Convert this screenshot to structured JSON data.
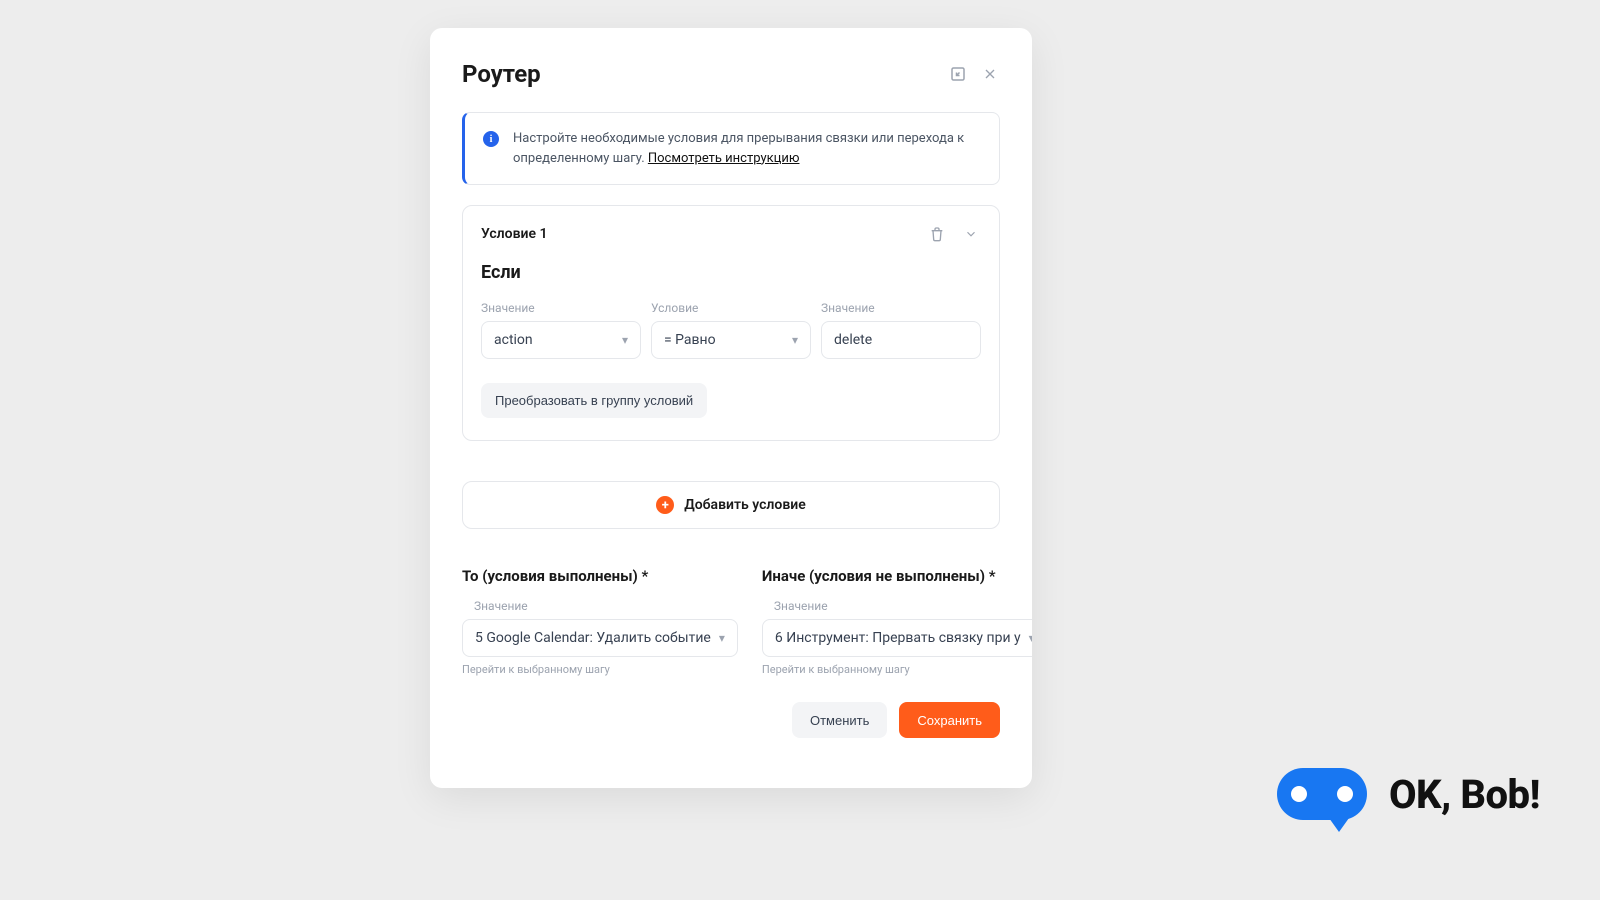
{
  "modal": {
    "title": "Роутер",
    "info_text": "Настройте необходимые условия для прерывания связки или перехода к определенному шагу. ",
    "info_link": "Посмотреть инструкцию"
  },
  "condition": {
    "title": "Условие 1",
    "if_label": "Если",
    "left_label": "Значение",
    "left_value": "action",
    "op_label": "Условие",
    "op_value": "=   Равно",
    "right_label": "Значение",
    "right_value": "delete",
    "convert_label": "Преобразовать в группу условий"
  },
  "add_condition_label": "Добавить условие",
  "then": {
    "title": "То (условия выполнены) *",
    "label": "Значение",
    "value": "5 Google Calendar: Удалить событие",
    "hint": "Перейти к выбранному шагу"
  },
  "else": {
    "title": "Иначе (условия не выполнены) *",
    "label": "Значение",
    "value": "6 Инструмент: Прервать связку при у",
    "hint": "Перейти к выбранному шагу"
  },
  "footer": {
    "cancel": "Отменить",
    "save": "Сохранить"
  },
  "brand": "OK, Bob!"
}
